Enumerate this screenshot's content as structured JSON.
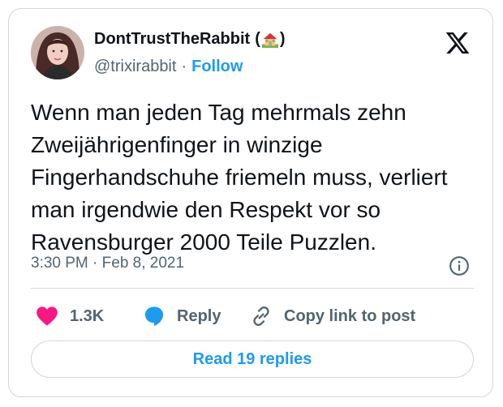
{
  "author": {
    "display_name": "DontTrustTheRabbit",
    "emoji_name": "house-with-garden-icon",
    "handle": "@trixirabbit",
    "separator": "·",
    "follow_label": "Follow"
  },
  "tweet": {
    "text": "Wenn man jeden Tag mehrmals zehn Zweijährigenfinger in winzige Fingerhandschuhe friemeln muss, verliert man irgendwie den Respekt vor so Ravensburger 2000 Teile Puzzlen.",
    "time": "3:30 PM",
    "separator": "·",
    "date": "Feb 8, 2021"
  },
  "actions": {
    "like_count": "1.3K",
    "reply_label": "Reply",
    "copy_label": "Copy link to post"
  },
  "read_replies_label": "Read 19 replies",
  "colors": {
    "accent": "#1d9bf0",
    "like": "#f91880",
    "text": "#0f1419",
    "secondary": "#536471",
    "border": "#cfd9de"
  }
}
